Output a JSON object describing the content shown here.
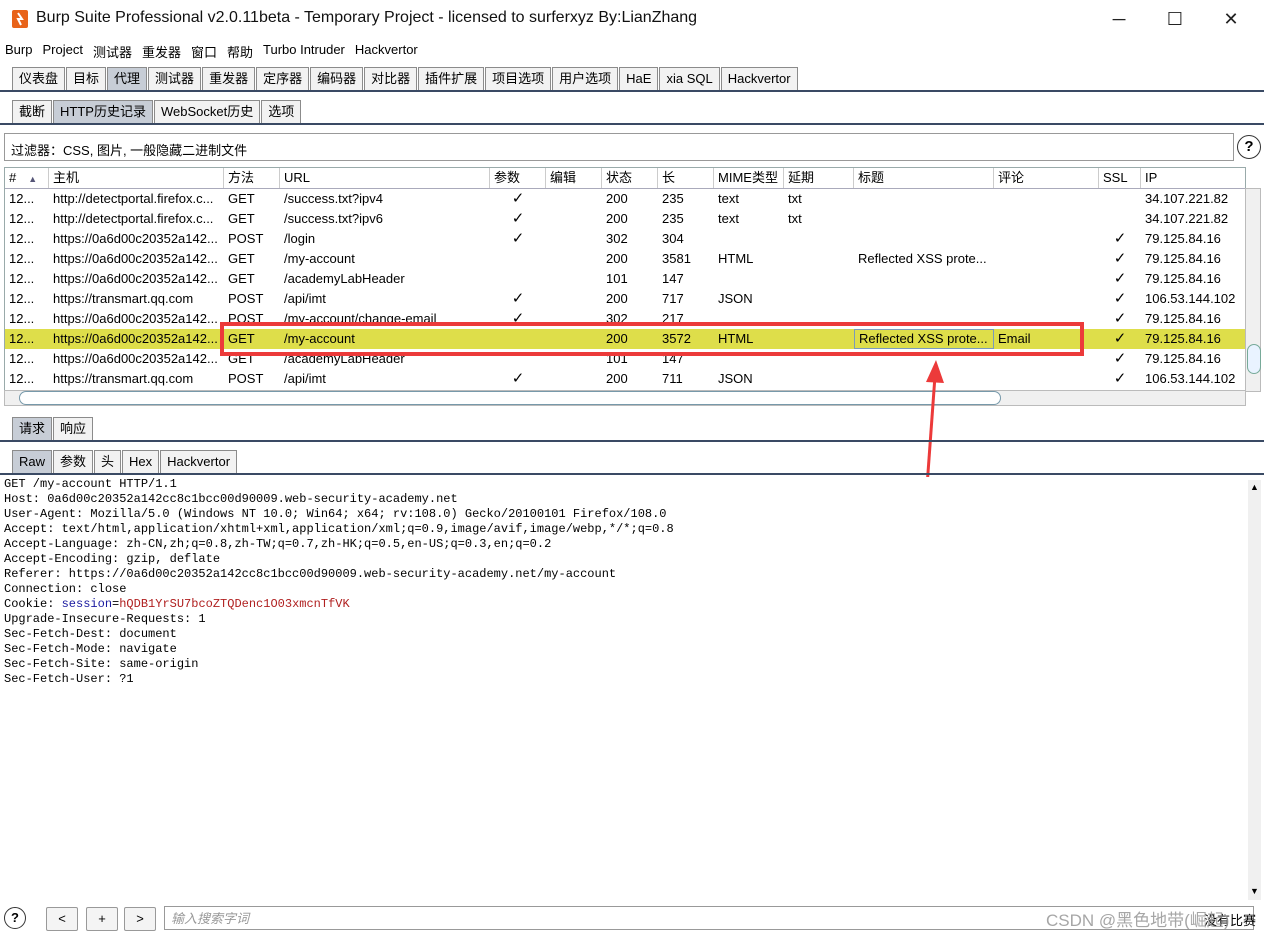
{
  "window": {
    "title": "Burp Suite Professional v2.0.11beta - Temporary Project - licensed to surferxyz By:LianZhang",
    "minimize": "─",
    "maximize": "☐",
    "close": "✕"
  },
  "menu": [
    "Burp",
    "Project",
    "测试器",
    "重发器",
    "窗口",
    "帮助",
    "Turbo Intruder",
    "Hackvertor"
  ],
  "main_tabs": [
    "仪表盘",
    "目标",
    "代理",
    "测试器",
    "重发器",
    "定序器",
    "编码器",
    "对比器",
    "插件扩展",
    "项目选项",
    "用户选项",
    "HaE",
    "xia SQL",
    "Hackvertor"
  ],
  "main_tab_active": 2,
  "proxy_tabs": [
    "截断",
    "HTTP历史记录",
    "WebSocket历史",
    "选项"
  ],
  "proxy_tab_active": 1,
  "filter": "过滤器：CSS, 图片, 一般隐藏二进制文件",
  "help": "?",
  "columns": [
    "#",
    "主机",
    "方法",
    "URL",
    "参数",
    "编辑",
    "状态",
    "长",
    "MIME类型",
    "延期",
    "标题",
    "评论",
    "SSL",
    "IP"
  ],
  "sort_indicator": "▲",
  "rows": [
    {
      "num": "12...",
      "host": "http://detectportal.firefox.c...",
      "method": "GET",
      "url": "/success.txt?ipv4",
      "params": "✓",
      "edited": "",
      "status": "200",
      "length": "235",
      "mime": "text",
      "ext": "txt",
      "title": "",
      "comment": "",
      "ssl": "",
      "ip": "34.107.221.82"
    },
    {
      "num": "12...",
      "host": "http://detectportal.firefox.c...",
      "method": "GET",
      "url": "/success.txt?ipv6",
      "params": "✓",
      "edited": "",
      "status": "200",
      "length": "235",
      "mime": "text",
      "ext": "txt",
      "title": "",
      "comment": "",
      "ssl": "",
      "ip": "34.107.221.82"
    },
    {
      "num": "12...",
      "host": "https://0a6d00c20352a142...",
      "method": "POST",
      "url": "/login",
      "params": "✓",
      "edited": "",
      "status": "302",
      "length": "304",
      "mime": "",
      "ext": "",
      "title": "",
      "comment": "",
      "ssl": "✓",
      "ip": "79.125.84.16"
    },
    {
      "num": "12...",
      "host": "https://0a6d00c20352a142...",
      "method": "GET",
      "url": "/my-account",
      "params": "",
      "edited": "",
      "status": "200",
      "length": "3581",
      "mime": "HTML",
      "ext": "",
      "title": "Reflected XSS prote...",
      "comment": "",
      "ssl": "✓",
      "ip": "79.125.84.16"
    },
    {
      "num": "12...",
      "host": "https://0a6d00c20352a142...",
      "method": "GET",
      "url": "/academyLabHeader",
      "params": "",
      "edited": "",
      "status": "101",
      "length": "147",
      "mime": "",
      "ext": "",
      "title": "",
      "comment": "",
      "ssl": "✓",
      "ip": "79.125.84.16"
    },
    {
      "num": "12...",
      "host": "https://transmart.qq.com",
      "method": "POST",
      "url": "/api/imt",
      "params": "✓",
      "edited": "",
      "status": "200",
      "length": "717",
      "mime": "JSON",
      "ext": "",
      "title": "",
      "comment": "",
      "ssl": "✓",
      "ip": "106.53.144.102"
    },
    {
      "num": "12...",
      "host": "https://0a6d00c20352a142...",
      "method": "POST",
      "url": "/my-account/change-email",
      "params": "✓",
      "edited": "",
      "status": "302",
      "length": "217",
      "mime": "",
      "ext": "",
      "title": "",
      "comment": "",
      "ssl": "✓",
      "ip": "79.125.84.16"
    },
    {
      "num": "12...",
      "host": "https://0a6d00c20352a142...",
      "method": "GET",
      "url": "/my-account",
      "params": "",
      "edited": "",
      "status": "200",
      "length": "3572",
      "mime": "HTML",
      "ext": "",
      "title": "Reflected XSS prote...",
      "comment": "Email",
      "ssl": "✓",
      "ip": "79.125.84.16",
      "selected": true
    },
    {
      "num": "12...",
      "host": "https://0a6d00c20352a142...",
      "method": "GET",
      "url": "/academyLabHeader",
      "params": "",
      "edited": "",
      "status": "101",
      "length": "147",
      "mime": "",
      "ext": "",
      "title": "",
      "comment": "",
      "ssl": "✓",
      "ip": "79.125.84.16"
    },
    {
      "num": "12...",
      "host": "https://transmart.qq.com",
      "method": "POST",
      "url": "/api/imt",
      "params": "✓",
      "edited": "",
      "status": "200",
      "length": "711",
      "mime": "JSON",
      "ext": "",
      "title": "",
      "comment": "",
      "ssl": "✓",
      "ip": "106.53.144.102"
    }
  ],
  "req_resp_tabs": [
    "请求",
    "响应"
  ],
  "view_tabs": [
    "Raw",
    "参数",
    "头",
    "Hex",
    "Hackvertor"
  ],
  "request_lines": [
    "GET /my-account HTTP/1.1",
    "Host: 0a6d00c20352a142cc8c1bcc00d90009.web-security-academy.net",
    "User-Agent: Mozilla/5.0 (Windows NT 10.0; Win64; x64; rv:108.0) Gecko/20100101 Firefox/108.0",
    "Accept: text/html,application/xhtml+xml,application/xml;q=0.9,image/avif,image/webp,*/*;q=0.8",
    "Accept-Language: zh-CN,zh;q=0.8,zh-TW;q=0.7,zh-HK;q=0.5,en-US;q=0.3,en;q=0.2",
    "Accept-Encoding: gzip, deflate",
    "Referer: https://0a6d00c20352a142cc8c1bcc00d90009.web-security-academy.net/my-account",
    "Connection: close"
  ],
  "cookie": {
    "prefix": "Cookie: ",
    "name": "session",
    "eq": "=",
    "value": "hQDB1YrSU7bcoZTQDenc1O03xmcnTfVK"
  },
  "request_lines_after": [
    "Upgrade-Insecure-Requests: 1",
    "Sec-Fetch-Dest: document",
    "Sec-Fetch-Mode: navigate",
    "Sec-Fetch-Site: same-origin",
    "Sec-Fetch-User: ?1"
  ],
  "bottom": {
    "help": "?",
    "prev": "<",
    "add": "+",
    "next": ">",
    "search_placeholder": "输入搜索字词",
    "watermark": "CSDN @黑色地带(崛起)",
    "match_status": "没有比赛"
  },
  "colors": {
    "selected_row": "#dede4a",
    "annotation": "#ec3a3a",
    "accent_line": "#3a4a64"
  }
}
